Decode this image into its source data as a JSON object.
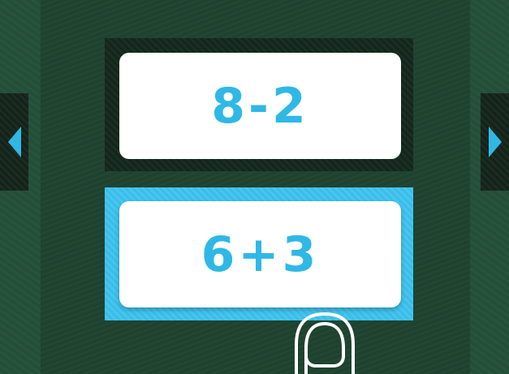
{
  "colors": {
    "accent": "#2fb8e6",
    "selected_frame": "#3bbde9",
    "card_bg": "#ffffff",
    "background": "#21412f"
  },
  "nav": {
    "prev_icon": "triangle-left-icon",
    "next_icon": "triangle-right-icon"
  },
  "cards": [
    {
      "expression": "8-2",
      "selected": false
    },
    {
      "expression": "6+3",
      "selected": true
    }
  ],
  "hint": {
    "icon": "finger-tap-icon"
  }
}
